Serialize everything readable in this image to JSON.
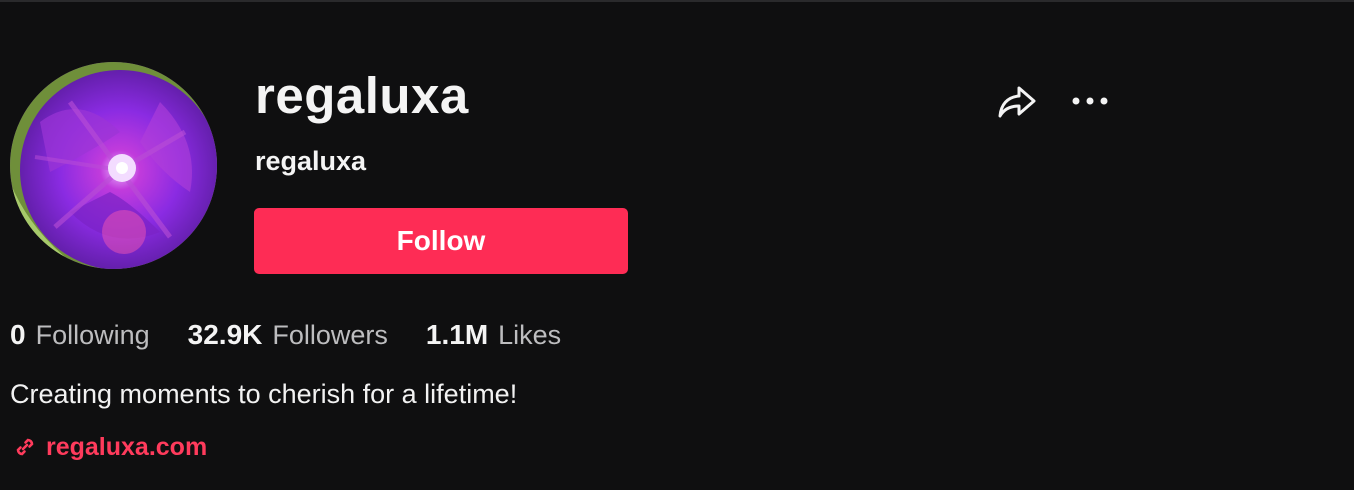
{
  "profile": {
    "display_name": "regaluxa",
    "username": "regaluxa",
    "bio": "Creating moments to cherish for a lifetime!",
    "website": "regaluxa.com",
    "avatar_icon": "flower-avatar"
  },
  "actions": {
    "follow_label": "Follow",
    "share_icon": "share-arrow-icon",
    "more_icon": "more-dots-icon"
  },
  "stats": [
    {
      "value": "0",
      "label": "Following"
    },
    {
      "value": "32.9K",
      "label": "Followers"
    },
    {
      "value": "1.1M",
      "label": "Likes"
    }
  ],
  "colors": {
    "background": "#0f0f10",
    "accent": "#fe2c55",
    "link": "#ff3b5c",
    "muted_text": "#bdbdbf"
  }
}
